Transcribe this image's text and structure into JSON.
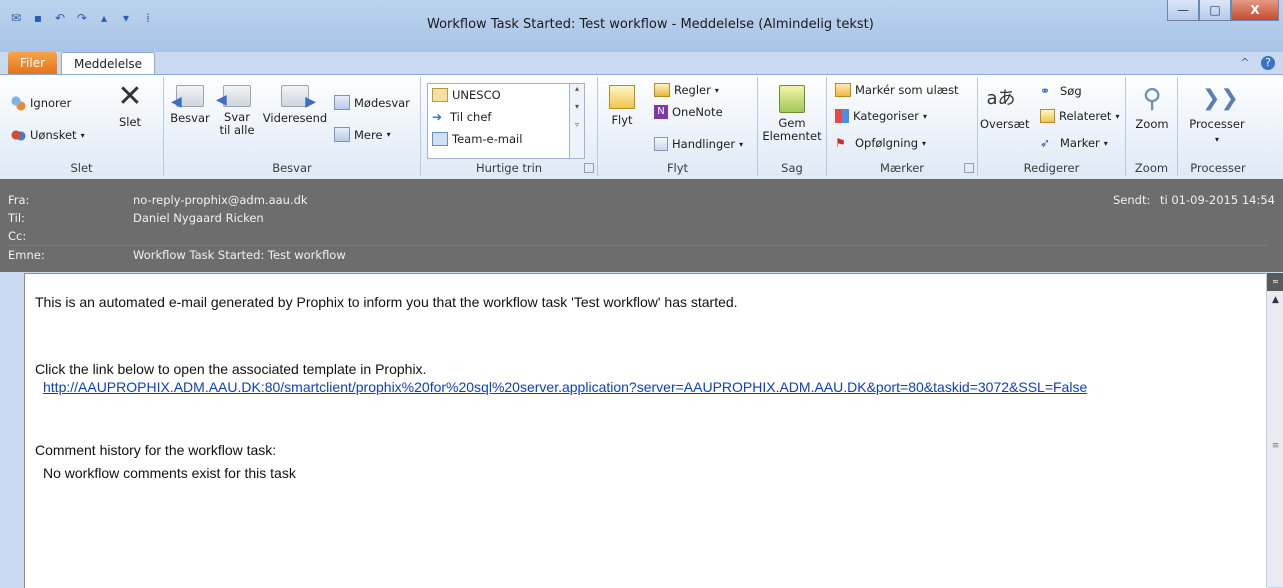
{
  "window": {
    "title": "Workflow Task Started: Test workflow  -  Meddelelse (Almindelig tekst)",
    "minimize": "—",
    "maximize": "□",
    "close": "X"
  },
  "tabs": {
    "file": "Filer",
    "message": "Meddelelse",
    "collapse": "^",
    "help": "?"
  },
  "ribbon": {
    "slet": {
      "label": "Slet",
      "ignore": "Ignorer",
      "junk": "Uønsket",
      "delete": "Slet"
    },
    "besvar": {
      "label": "Besvar",
      "reply": "Besvar",
      "reply_all_1": "Svar",
      "reply_all_2": "til alle",
      "forward": "Videresend",
      "meeting": "Mødesvar",
      "more": "Mere"
    },
    "quick": {
      "label": "Hurtige trin",
      "items": [
        "UNESCO",
        "Til chef",
        "Team-e-mail"
      ]
    },
    "flyt": {
      "label": "Flyt",
      "move": "Flyt",
      "rules": "Regler",
      "onenote": "OneNote",
      "actions": "Handlinger"
    },
    "sag": {
      "label": "Sag",
      "save_1": "Gem",
      "save_2": "Elementet"
    },
    "maerker": {
      "label": "Mærker",
      "unread": "Markér som ulæst",
      "categorize": "Kategoriser",
      "followup": "Opfølgning"
    },
    "rediger": {
      "label": "Redigerer",
      "translate": "Oversæt",
      "find": "Søg",
      "related": "Relateret",
      "select": "Marker"
    },
    "zoom": {
      "label": "Zoom",
      "zoom": "Zoom"
    },
    "processer": {
      "label": "Processer",
      "process": "Processer"
    }
  },
  "header": {
    "from_label": "Fra:",
    "from": "no-reply-prophix@adm.aau.dk",
    "to_label": "Til:",
    "to": "Daniel Nygaard Ricken",
    "cc_label": "Cc:",
    "cc": "",
    "subject_label": "Emne:",
    "subject": "Workflow Task Started: Test workflow",
    "sent_label": "Sendt:",
    "sent": "ti 01-09-2015 14:54"
  },
  "body": {
    "line1": "This is an automated e-mail generated by Prophix to inform you that the workflow task 'Test workflow' has started.",
    "line2": "Click the link below to open the associated template in Prophix.",
    "link": "http://AAUPROPHIX.ADM.AAU.DK:80/smartclient/prophix%20for%20sql%20server.application?server=AAUPROPHIX.ADM.AAU.DK&port=80&taskid=3072&SSL=False",
    "line3": "Comment history for the workflow task:",
    "line4": "No workflow comments exist for this task"
  },
  "colors": {
    "file_tab": "#e27617",
    "header_bg": "#6d6d6d",
    "link": "#0b3ecb"
  }
}
